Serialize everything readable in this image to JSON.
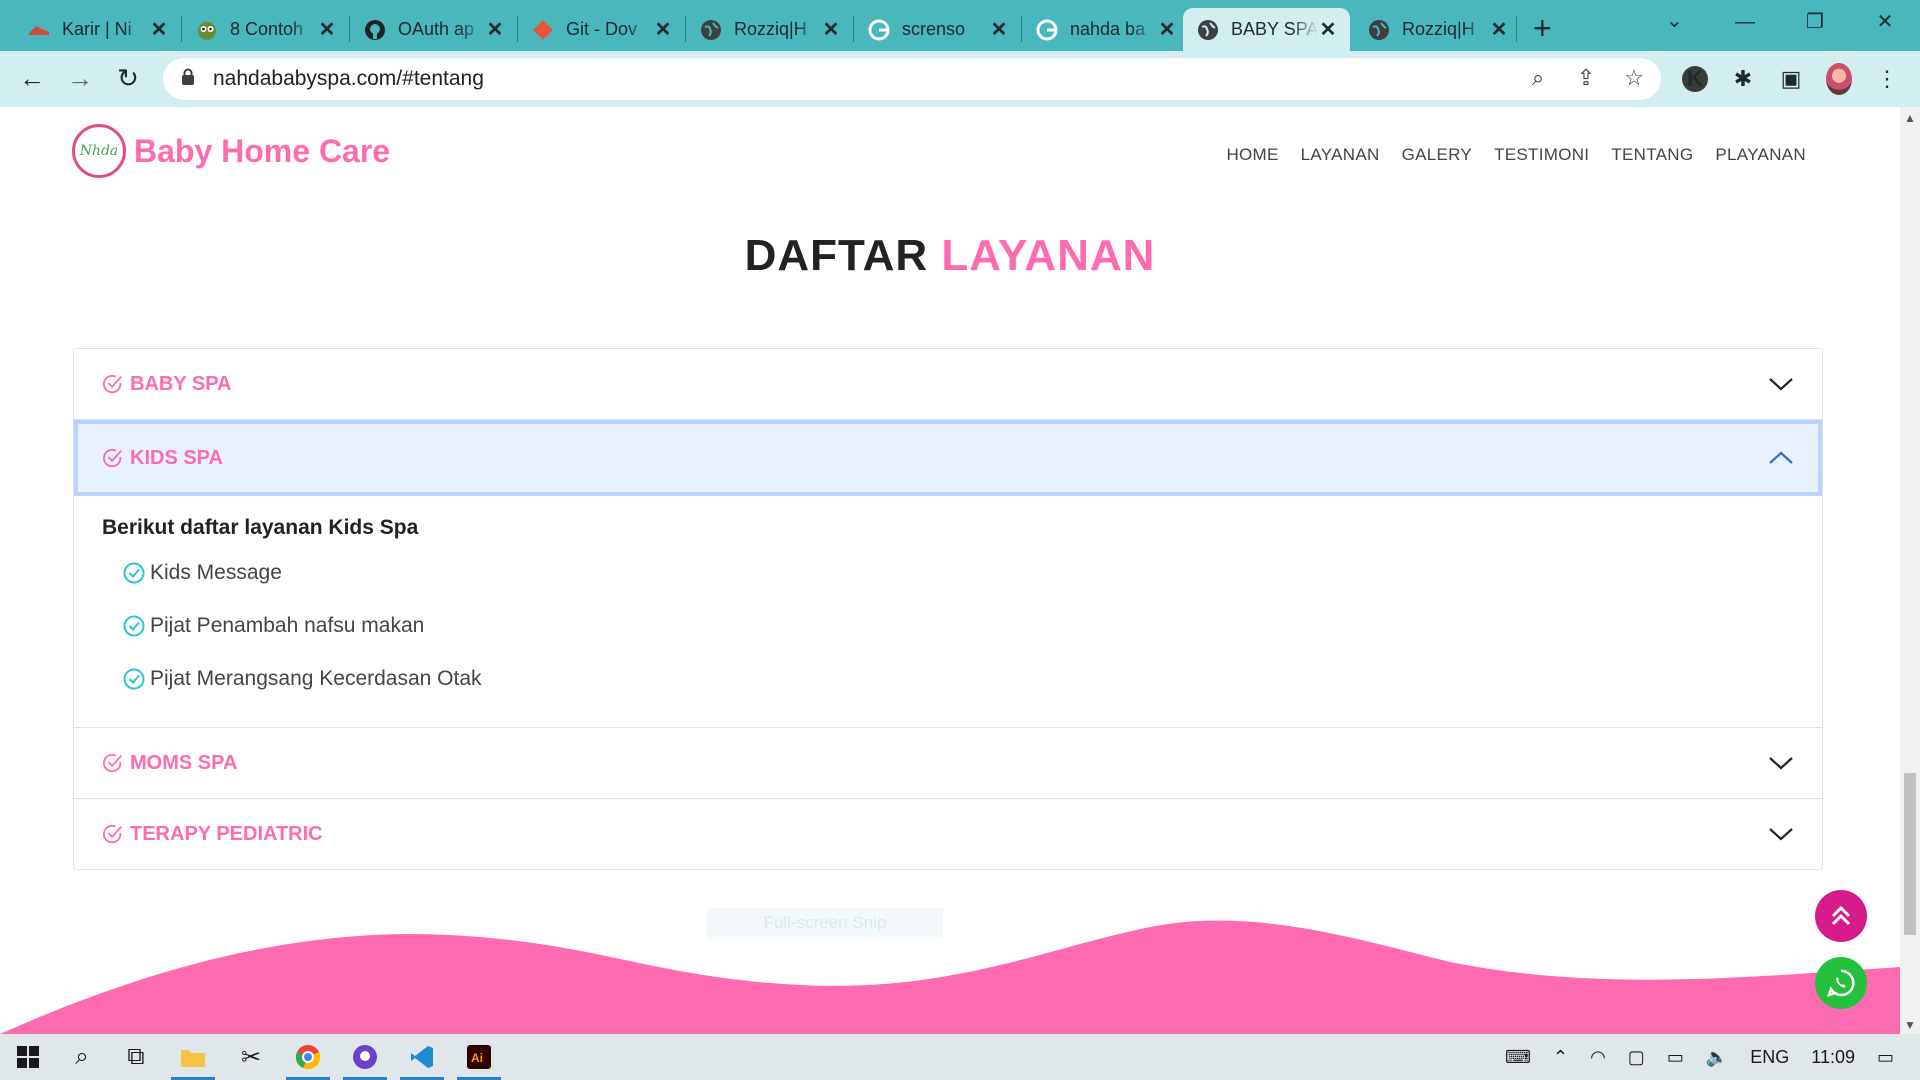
{
  "browser": {
    "tabs": [
      {
        "title": "Karir | Ni",
        "icon": "shoe-icon",
        "active": false
      },
      {
        "title": "8 Contoh",
        "icon": "owl-icon",
        "active": false
      },
      {
        "title": "OAuth ap",
        "icon": "github-icon",
        "active": false
      },
      {
        "title": "Git - Dov",
        "icon": "git-icon",
        "active": false
      },
      {
        "title": "Rozziq|H",
        "icon": "globe-icon",
        "active": false
      },
      {
        "title": "screnso",
        "icon": "google-icon",
        "active": false
      },
      {
        "title": "nahda ba",
        "icon": "google-icon",
        "active": false
      },
      {
        "title": "BABY SPA",
        "icon": "globe-icon",
        "active": true
      },
      {
        "title": "Rozziq|H",
        "icon": "globe-icon",
        "active": false
      }
    ],
    "url": "nahdababyspa.com/#tentang"
  },
  "site": {
    "logo_text": "Nhda",
    "brand_name": "Baby Home Care",
    "nav": [
      "HOME",
      "LAYANAN",
      "GALERY",
      "TESTIMONI",
      "TENTANG",
      "PLAYANAN"
    ]
  },
  "section": {
    "title_dark": "DAFTAR",
    "title_pink": "LAYANAN"
  },
  "accordion": [
    {
      "label": "BABY SPA",
      "open": false
    },
    {
      "label": "KIDS SPA",
      "open": true,
      "intro": "Berikut daftar layanan Kids Spa",
      "items": [
        "Kids Message",
        "Pijat Penambah nafsu makan",
        "Pijat Merangsang Kecerdasan Otak"
      ]
    },
    {
      "label": "MOMS SPA",
      "open": false
    },
    {
      "label": "TERAPY PEDIATRIC",
      "open": false
    }
  ],
  "overlay": {
    "snip_label": "Full-screen Snip"
  },
  "taskbar": {
    "apps": [
      "windows-start-icon",
      "search-icon",
      "task-view-icon",
      "file-explorer-icon",
      "snipping-icon",
      "chrome-icon",
      "github-desktop-icon",
      "vscode-icon",
      "illustrator-icon"
    ],
    "language": "ENG",
    "time": "11:09"
  },
  "colors": {
    "brand_pink": "#ff6bb1",
    "tab_bar": "#4ab7bd",
    "fab_top": "#d81b8c",
    "whatsapp": "#25c03e"
  }
}
